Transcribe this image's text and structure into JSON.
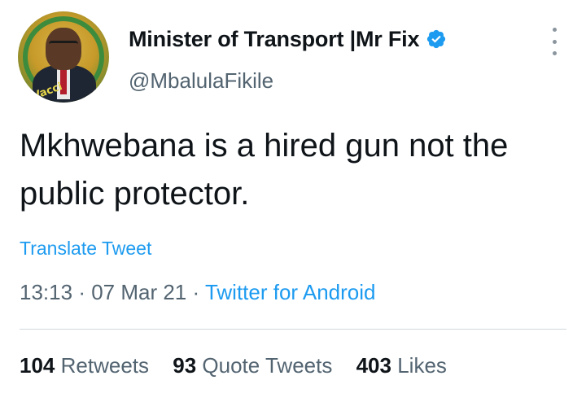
{
  "author": {
    "display_name": "Minister of Transport |Mr Fix",
    "handle": "@MbalulaFikile",
    "verified": true,
    "avatar_tag": "#Vacci"
  },
  "tweet": {
    "text": "Mkhwebana is a hired gun not the public protector.",
    "translate_label": "Translate Tweet",
    "time": "13:13",
    "date": "07 Mar 21",
    "source": "Twitter for Android"
  },
  "stats": {
    "retweets_count": "104",
    "retweets_label": "Retweets",
    "quote_count": "93",
    "quote_label": "Quote Tweets",
    "likes_count": "403",
    "likes_label": "Likes"
  },
  "icons": {
    "verified": "verified-badge-icon",
    "more": "more-options-icon"
  },
  "colors": {
    "link": "#1d9bf0",
    "secondary_text": "#536471",
    "primary_text": "#0f1419",
    "divider": "#cfd9de"
  }
}
